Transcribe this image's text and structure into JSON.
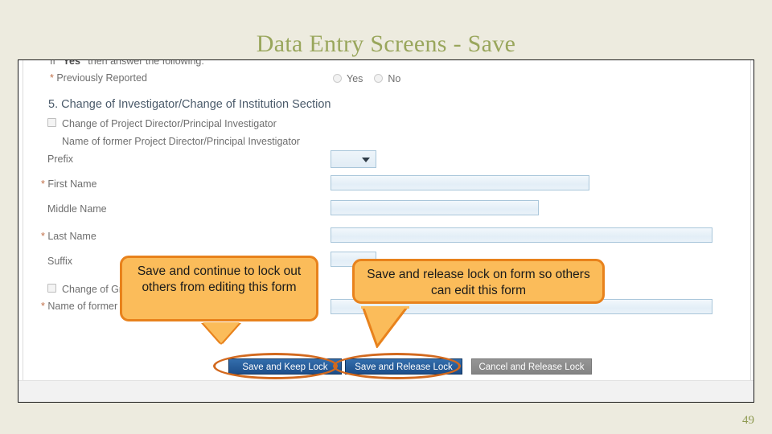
{
  "slide": {
    "title": "Data Entry Screens - Save",
    "page_number": "49",
    "accent_color": "#99a65c",
    "background_color": "#edebdf"
  },
  "screenshot": {
    "cut_row": {
      "prefix": "If ",
      "quoted": "\"Yes\"",
      "suffix": " then answer the following:"
    },
    "previously_reported": {
      "label_star": "*",
      "label": " Previously Reported",
      "options": [
        {
          "label": "Yes",
          "selected": false
        },
        {
          "label": "No",
          "selected": false
        }
      ]
    },
    "section_heading": "5. Change of Investigator/Change of Institution Section",
    "checkbox_pi": {
      "label": "Change of Project Director/Principal Investigator",
      "checked": false
    },
    "name_former_pi_label": "Name of former Project Director/Principal Investigator",
    "fields": [
      {
        "name": "prefix",
        "star": "",
        "label": "Prefix",
        "type": "select",
        "value": ""
      },
      {
        "name": "first_name",
        "star": "*",
        "label": " First Name",
        "type": "text",
        "value": ""
      },
      {
        "name": "middle_name",
        "star": "",
        "label": "Middle Name",
        "type": "text",
        "value": ""
      },
      {
        "name": "last_name",
        "star": "*",
        "label": " Last Name",
        "type": "text",
        "value": ""
      },
      {
        "name": "suffix",
        "star": "",
        "label": "Suffix",
        "type": "text",
        "value": ""
      }
    ],
    "checkbox_grantee": {
      "label": "Change of Gra",
      "checked": false
    },
    "name_former_grantee_label_star": "*",
    "name_former_grantee_label": " Name of former",
    "buttons": [
      {
        "name": "save-and-keep-lock",
        "label": "Save and Keep Lock",
        "style": "blue"
      },
      {
        "name": "save-and-release-lock",
        "label": "Save and Release Lock",
        "style": "blue"
      },
      {
        "name": "cancel-and-release-lock",
        "label": "Cancel and Release Lock",
        "style": "gray"
      }
    ]
  },
  "annotations": {
    "callout_left": "Save and continue to lock out others from editing this form",
    "callout_right": "Save and release lock on form so others can edit this form",
    "highlight_color": "#d2691e",
    "callout_fill": "#fbbc5a",
    "callout_border": "#e8821c"
  }
}
